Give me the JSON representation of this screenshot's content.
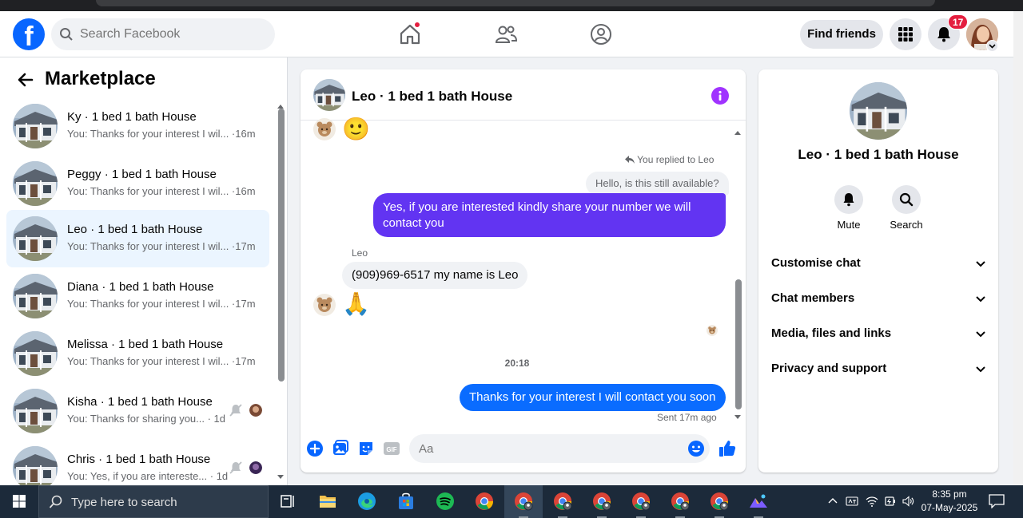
{
  "header": {
    "search_placeholder": "Search Facebook",
    "find_friends_label": "Find friends",
    "notification_count": "17"
  },
  "marketplace": {
    "title": "Marketplace",
    "conversations": [
      {
        "name": "Ky · 1 bed 1 bath House",
        "preview": "You: Thanks for your interest I wil... ·16m",
        "active": false
      },
      {
        "name": "Peggy · 1 bed 1 bath House",
        "preview": "You: Thanks for your interest I wil... ·16m",
        "active": false
      },
      {
        "name": "Leo · 1 bed 1 bath House",
        "preview": "You: Thanks for your interest I wil... ·17m",
        "active": true
      },
      {
        "name": "Diana · 1 bed 1 bath House",
        "preview": "You: Thanks for your interest I wil... ·17m",
        "active": false
      },
      {
        "name": "Melissa · 1 bed 1 bath House",
        "preview": "You: Thanks for your interest I wil... ·17m",
        "active": false
      },
      {
        "name": "Kisha · 1 bed 1 bath House",
        "preview": "You: Thanks for sharing you... · 1d",
        "active": false,
        "muted": true
      },
      {
        "name": "Chris · 1 bed 1 bath House",
        "preview": "You: Yes, if you are intereste... · 1d",
        "active": false,
        "muted": true
      }
    ]
  },
  "chat": {
    "title": "Leo · 1 bed 1 bath House",
    "reply_note": "You replied to Leo",
    "quoted_message": "Hello, is this still available?",
    "my_reply": "Yes, if you are interested kindly share your number we will contact you",
    "sender_name": "Leo",
    "their_message": "(909)969-6517 my name is Leo",
    "timestamp": "20:18",
    "last_message": "Thanks for your interest I will contact you soon",
    "sent_status": "Sent 17m ago",
    "input_placeholder": "Aa"
  },
  "info_panel": {
    "name": "Leo · 1 bed 1 bath House",
    "actions": [
      "Mute",
      "Search"
    ],
    "sections": [
      "Customise chat",
      "Chat members",
      "Media, files and links",
      "Privacy and support"
    ]
  },
  "taskbar": {
    "search_placeholder": "Type here to search",
    "time": "8:35 pm",
    "date": "07-May-2025"
  },
  "colors": {
    "fb_blue": "#0866ff",
    "my_bubble_purple": "#6234f2",
    "my_bubble_blue": "#0a6cff",
    "info_purple": "#a033ff",
    "badge_red": "#e41e3f"
  }
}
